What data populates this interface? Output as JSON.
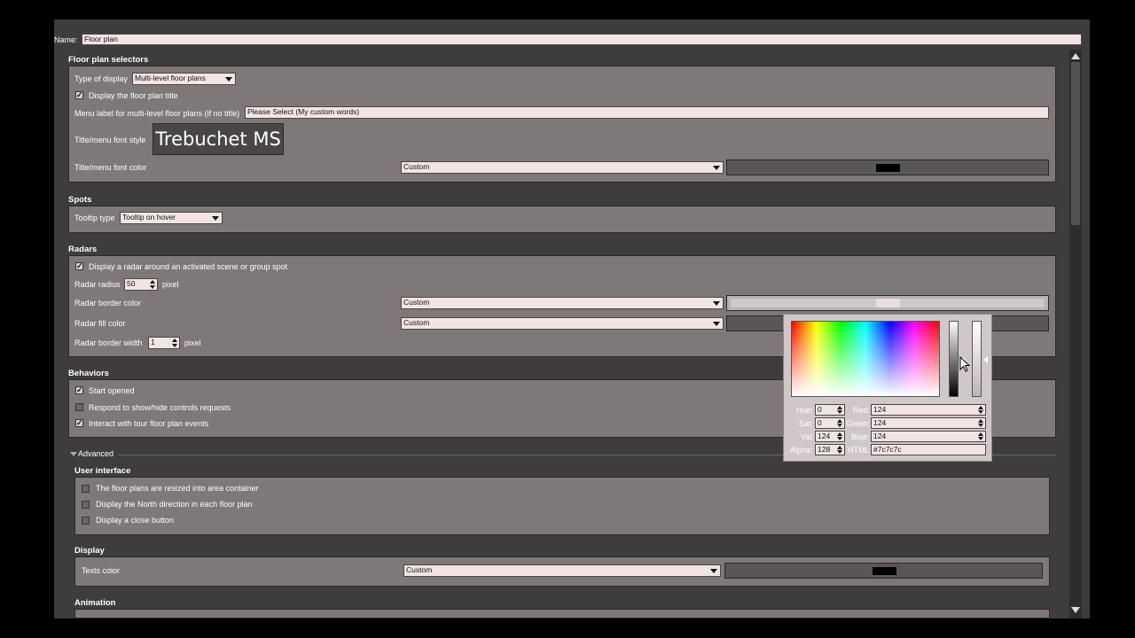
{
  "name": {
    "label": "Name:",
    "value": "Floor plan"
  },
  "floor_plan_selectors": {
    "header": "Floor plan selectors",
    "type_label": "Type of display",
    "type_value": "Multi-level floor plans",
    "display_title_label": "Display the floor plan title",
    "menu_label_label": "Menu label for multi-level floor plans (if no title)",
    "menu_label_value": "Please Select (My custom words)",
    "font_style_label": "Title/menu font style",
    "font_style_value": "Trebuchet MS",
    "font_color_label": "Title/menu font color",
    "font_color_value": "Custom"
  },
  "spots": {
    "header": "Spots",
    "tooltip_label": "Tooltip type",
    "tooltip_value": "Tooltip on hover"
  },
  "radars": {
    "header": "Radars",
    "display_radar_label": "Display a radar around an activated scene or group spot",
    "radius_label": "Radar radius",
    "radius_value": "50",
    "radius_unit": "pixel",
    "border_color_label": "Radar border color",
    "border_color_value": "Custom",
    "fill_color_label": "Radar fill color",
    "fill_color_value": "Custom",
    "border_width_label": "Radar border width",
    "border_width_value": "1",
    "border_width_unit": "pixel"
  },
  "behaviors": {
    "header": "Behaviors",
    "start_opened": "Start opened",
    "respond_label": "Respond to show/hide controls requests",
    "interact_label": "Interact with tour floor plan events"
  },
  "advanced": {
    "label": "Advanced"
  },
  "user_interface": {
    "header": "User interface",
    "resized_label": "The floor plans are resized into area container",
    "north_label": "Display the North direction in each floor plan",
    "close_label": "Display a close button"
  },
  "display": {
    "header": "Display",
    "texts_color_label": "Texts color",
    "texts_color_value": "Custom"
  },
  "animation": {
    "header": "Animation"
  },
  "color_picker": {
    "hue_label": "Hue:",
    "hue_value": "0",
    "sat_label": "Sat:",
    "sat_value": "0",
    "val_label": "Val:",
    "val_value": "124",
    "alpha_label": "Alpha:",
    "alpha_value": "128",
    "red_label": "Red:",
    "red_value": "124",
    "green_label": "Green:",
    "green_value": "124",
    "blue_label": "Blue:",
    "blue_value": "124",
    "html_label": "HTML:",
    "html_value": "#7c7c7c"
  },
  "colors": {
    "background": "#3e3c3c",
    "panel": "#7f7878",
    "field": "#f3e4e4",
    "picked": "#7c7c7c"
  }
}
